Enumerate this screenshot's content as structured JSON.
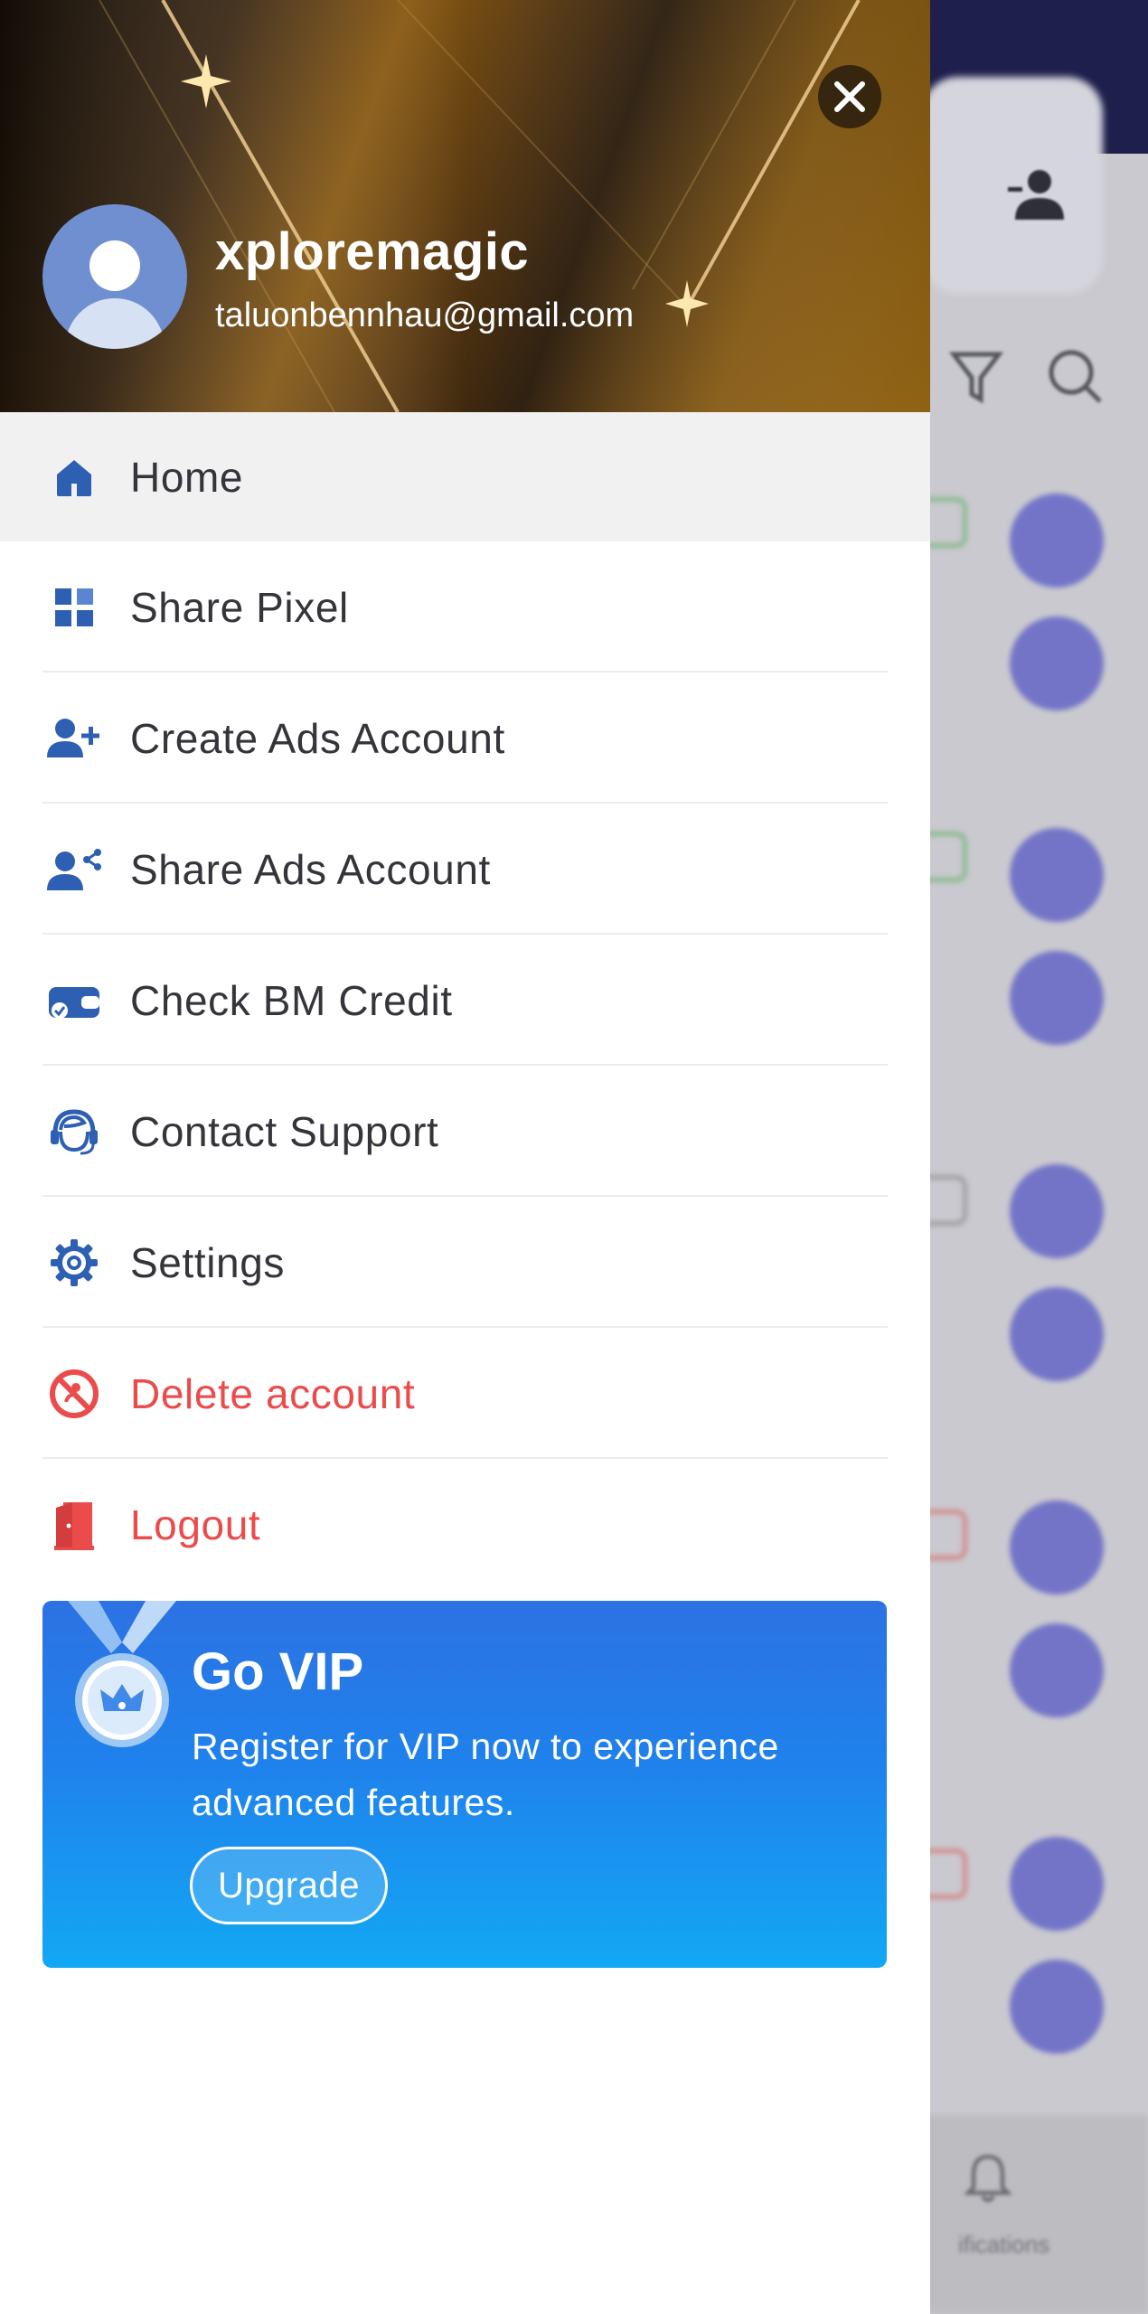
{
  "user": {
    "name": "xploremagic",
    "email": "taluonbennhau@gmail.com"
  },
  "menu": {
    "items": [
      {
        "label": "Home",
        "icon": "home-icon"
      },
      {
        "label": "Share Pixel",
        "icon": "grid-icon"
      },
      {
        "label": "Create Ads Account",
        "icon": "add-user-icon"
      },
      {
        "label": "Share Ads Account",
        "icon": "share-user-icon"
      },
      {
        "label": "Check BM Credit",
        "icon": "wallet-check-icon"
      },
      {
        "label": "Contact Support",
        "icon": "headset-icon"
      },
      {
        "label": "Settings",
        "icon": "gear-icon"
      },
      {
        "label": "Delete account",
        "icon": "block-icon"
      },
      {
        "label": "Logout",
        "icon": "door-exit-icon"
      }
    ]
  },
  "vip": {
    "title": "Go VIP",
    "description": "Register for VIP now to experience advanced features.",
    "button_label": "Upgrade"
  },
  "background": {
    "bottom_nav_partial_label": "ifications"
  },
  "colors": {
    "accent_blue": "#2d5fb3",
    "danger_red": "#ec4b4b",
    "vip_gradient_top": "#2c72e3",
    "vip_gradient_bottom": "#12a8f4",
    "header_gold": "#8a5a12"
  }
}
